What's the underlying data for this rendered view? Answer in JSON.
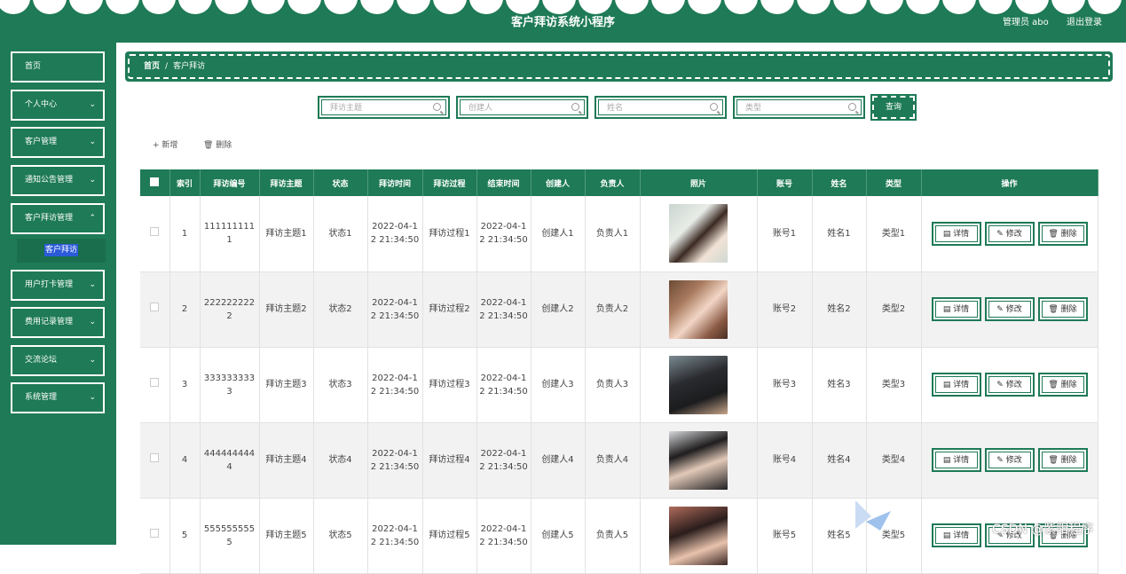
{
  "header": {
    "title": "客户拜访系统小程序",
    "user": "管理员 abo",
    "logout": "退出登录"
  },
  "sidebar": {
    "items": [
      {
        "label": "首页",
        "arrow": ""
      },
      {
        "label": "个人中心",
        "arrow": "⌄"
      },
      {
        "label": "客户管理",
        "arrow": "⌄"
      },
      {
        "label": "通知公告管理",
        "arrow": "⌄"
      },
      {
        "label": "客户拜访管理",
        "arrow": "⌃"
      },
      {
        "label": "用户打卡管理",
        "arrow": "⌄"
      },
      {
        "label": "费用记录管理",
        "arrow": "⌄"
      },
      {
        "label": "交流论坛",
        "arrow": "⌄"
      },
      {
        "label": "系统管理",
        "arrow": "⌄"
      }
    ],
    "sub_item": "客户拜访"
  },
  "breadcrumb": {
    "home": "首页",
    "sep": "/",
    "current": "客户拜访"
  },
  "search": {
    "fields": [
      {
        "placeholder": "拜访主题"
      },
      {
        "placeholder": "创建人"
      },
      {
        "placeholder": "姓名"
      },
      {
        "placeholder": "类型"
      }
    ],
    "button": "查询"
  },
  "toolbar": {
    "add": "+ 新增",
    "delete": "🗑 删除"
  },
  "table": {
    "headers": [
      "",
      "索引",
      "拜访编号",
      "拜访主题",
      "状态",
      "拜访时间",
      "拜访过程",
      "结束时间",
      "创建人",
      "负责人",
      "照片",
      "账号",
      "姓名",
      "类型",
      "操作"
    ],
    "rows": [
      {
        "index": "1",
        "code": "111111111\n1",
        "topic": "拜访主题1",
        "status": "状态1",
        "visit_time": "2022-04-1\n2 21:34:50",
        "process": "拜访过程1",
        "end_time": "2022-04-1\n2 21:34:50",
        "creator": "创建人1",
        "owner": "负责人1",
        "account": "账号1",
        "name": "姓名1",
        "type": "类型1"
      },
      {
        "index": "2",
        "code": "222222222\n2",
        "topic": "拜访主题2",
        "status": "状态2",
        "visit_time": "2022-04-1\n2 21:34:50",
        "process": "拜访过程2",
        "end_time": "2022-04-1\n2 21:34:50",
        "creator": "创建人2",
        "owner": "负责人2",
        "account": "账号2",
        "name": "姓名2",
        "type": "类型2"
      },
      {
        "index": "3",
        "code": "333333333\n3",
        "topic": "拜访主题3",
        "status": "状态3",
        "visit_time": "2022-04-1\n2 21:34:50",
        "process": "拜访过程3",
        "end_time": "2022-04-1\n2 21:34:50",
        "creator": "创建人3",
        "owner": "负责人3",
        "account": "账号3",
        "name": "姓名3",
        "type": "类型3"
      },
      {
        "index": "4",
        "code": "444444444\n4",
        "topic": "拜访主题4",
        "status": "状态4",
        "visit_time": "2022-04-1\n2 21:34:50",
        "process": "拜访过程4",
        "end_time": "2022-04-1\n2 21:34:50",
        "creator": "创建人4",
        "owner": "负责人4",
        "account": "账号4",
        "name": "姓名4",
        "type": "类型4"
      },
      {
        "index": "5",
        "code": "555555555\n5",
        "topic": "拜访主题5",
        "status": "状态5",
        "visit_time": "2022-04-1\n2 21:34:50",
        "process": "拜访过程5",
        "end_time": "2022-04-1\n2 21:34:50",
        "creator": "创建人5",
        "owner": "负责人5",
        "account": "账号5",
        "name": "姓名5",
        "type": "类型5"
      }
    ],
    "actions": {
      "detail": "▤ 详情",
      "edit": "✎ 修改",
      "delete": "🗑 删除"
    }
  },
  "watermark": "CSDN @紫阳程序",
  "colors": {
    "primary": "#1e7a57"
  }
}
